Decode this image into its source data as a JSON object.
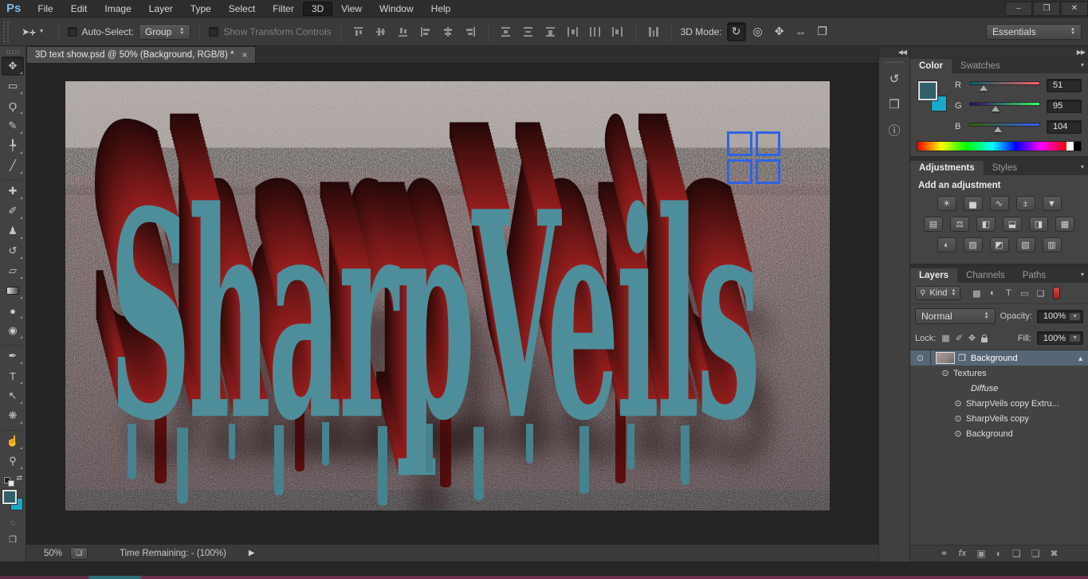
{
  "window": {
    "minimize": "–",
    "restore": "❐",
    "close": "✕"
  },
  "menubar": {
    "logo": "Ps",
    "items": [
      {
        "name": "menu-file",
        "label": "File"
      },
      {
        "name": "menu-edit",
        "label": "Edit"
      },
      {
        "name": "menu-image",
        "label": "Image"
      },
      {
        "name": "menu-layer",
        "label": "Layer"
      },
      {
        "name": "menu-type",
        "label": "Type"
      },
      {
        "name": "menu-select",
        "label": "Select"
      },
      {
        "name": "menu-filter",
        "label": "Filter"
      },
      {
        "name": "menu-3d",
        "label": "3D",
        "cls": "active"
      },
      {
        "name": "menu-view",
        "label": "View"
      },
      {
        "name": "menu-window",
        "label": "Window"
      },
      {
        "name": "menu-help",
        "label": "Help"
      }
    ]
  },
  "options": {
    "auto_select_label": "Auto-Select:",
    "group_value": "Group",
    "show_transform_label": "Show Transform Controls",
    "mode_label": "3D Mode:",
    "modes": [
      {
        "name": "3d-rotate-mode",
        "glyph": "↻",
        "cls": "active"
      },
      {
        "name": "3d-roll-mode",
        "glyph": "◎"
      },
      {
        "name": "3d-drag-mode",
        "glyph": "✥"
      },
      {
        "name": "3d-slide-mode",
        "glyph": "⇔"
      },
      {
        "name": "3d-scale-mode",
        "glyph": "❒"
      }
    ],
    "workspace_value": "Essentials"
  },
  "doc_tab": {
    "title": "3D text show.psd @ 50% (Background, RGB/8) *",
    "close_glyph": "×"
  },
  "tools": [
    {
      "name": "move-tool",
      "glyph": "✥",
      "cls": "selected"
    },
    {
      "name": "marquee-tool",
      "glyph": "▭"
    },
    {
      "name": "lasso-tool",
      "glyph": "Ϙ"
    },
    {
      "name": "quick-selection-tool",
      "glyph": "✎"
    },
    {
      "name": "crop-tool",
      "glyph": "╄"
    },
    {
      "name": "eyedropper-tool",
      "glyph": "╱"
    },
    {
      "cls": "divider"
    },
    {
      "name": "healing-brush-tool",
      "glyph": "✚"
    },
    {
      "name": "brush-tool",
      "glyph": "✐"
    },
    {
      "name": "clone-stamp-tool",
      "glyph": "♟"
    },
    {
      "name": "history-brush-tool",
      "glyph": "↺"
    },
    {
      "name": "eraser-tool",
      "glyph": "▱"
    },
    {
      "name": "gradient-tool",
      "glyph": "",
      "cls": "grad-sw"
    },
    {
      "name": "blur-tool",
      "glyph": "●"
    },
    {
      "name": "dodge-tool",
      "glyph": "◉"
    },
    {
      "cls": "divider"
    },
    {
      "name": "pen-tool",
      "glyph": "✒"
    },
    {
      "name": "type-tool",
      "glyph": "T"
    },
    {
      "name": "path-selection-tool",
      "glyph": "↖"
    },
    {
      "name": "custom-shape-tool",
      "glyph": "❋"
    },
    {
      "cls": "divider"
    },
    {
      "name": "hand-tool",
      "glyph": "☝"
    },
    {
      "name": "zoom-tool",
      "glyph": "⚲"
    }
  ],
  "dock": {
    "collapse_glyph": "◀◀",
    "expand_glyph": "▶▶",
    "items": [
      {
        "name": "history-panel-button",
        "glyph": "↺"
      },
      {
        "name": "3d-panel-button",
        "glyph": "❒"
      },
      {
        "name": "info-panel-button",
        "glyph": "ⓘ"
      }
    ]
  },
  "color_panel": {
    "tabs": [
      {
        "name": "tab-color",
        "label": "Color",
        "cls": "active"
      },
      {
        "name": "tab-swatches",
        "label": "Swatches"
      }
    ],
    "menu_glyph": "≣",
    "channels": [
      {
        "label": "R",
        "value": "51",
        "grad": "linear-gradient(90deg,#005F68,#FF5F68)",
        "pos": "20%"
      },
      {
        "label": "G",
        "value": "95",
        "grad": "linear-gradient(90deg,#330068,#33FF68)",
        "pos": "37%"
      },
      {
        "label": "B",
        "value": "104",
        "grad": "linear-gradient(90deg,#335F00,#335FFF)",
        "pos": "41%"
      }
    ]
  },
  "adjustments_panel": {
    "tabs": [
      {
        "name": "tab-adjustments",
        "label": "Adjustments",
        "cls": "active"
      },
      {
        "name": "tab-styles",
        "label": "Styles"
      }
    ],
    "menu_glyph": "≣",
    "heading": "Add an adjustment",
    "row1": [
      {
        "name": "brightness-contrast-adjustment",
        "glyph": "☀"
      },
      {
        "name": "levels-adjustment",
        "glyph": "▅"
      },
      {
        "name": "curves-adjustment",
        "glyph": "∿"
      },
      {
        "name": "exposure-adjustment",
        "glyph": "±"
      },
      {
        "name": "vibrance-adjustment",
        "glyph": "▼"
      }
    ],
    "row2": [
      {
        "name": "hue-saturation-adjustment",
        "glyph": "▤"
      },
      {
        "name": "color-balance-adjustment",
        "glyph": "⚖"
      },
      {
        "name": "black-white-adjustment",
        "glyph": "◧"
      },
      {
        "name": "photo-filter-adjustment",
        "glyph": "⬓"
      },
      {
        "name": "channel-mixer-adjustment",
        "glyph": "◨"
      },
      {
        "name": "color-lookup-adjustment",
        "glyph": "▦"
      }
    ],
    "row3": [
      {
        "name": "invert-adjustment",
        "glyph": "◐"
      },
      {
        "name": "posterize-adjustment",
        "glyph": "▨"
      },
      {
        "name": "threshold-adjustment",
        "glyph": "◩"
      },
      {
        "name": "gradient-map-adjustment",
        "glyph": "▧"
      },
      {
        "name": "selective-color-adjustment",
        "glyph": "▥"
      }
    ]
  },
  "layers_panel": {
    "tabs": [
      {
        "name": "tab-layers",
        "label": "Layers",
        "cls": "active"
      },
      {
        "name": "tab-channels",
        "label": "Channels"
      },
      {
        "name": "tab-paths",
        "label": "Paths"
      }
    ],
    "menu_glyph": "≣",
    "search_glyph": "⚲",
    "kind_value": "Kind",
    "filter_icons": [
      {
        "name": "filter-pixel-layers",
        "glyph": "▩"
      },
      {
        "name": "filter-adjustment-layers",
        "glyph": "◐"
      },
      {
        "name": "filter-type-layers",
        "glyph": "T"
      },
      {
        "name": "filter-shape-layers",
        "glyph": "▭"
      },
      {
        "name": "filter-smart-objects",
        "glyph": "❏"
      }
    ],
    "blend_value": "Normal",
    "opacity_label": "Opacity:",
    "opacity_value": "100%",
    "lock_label": "Lock:",
    "lock_transparency_glyph": "▦",
    "lock_paint_glyph": "✐",
    "lock_position_glyph": "✥",
    "fill_label": "Fill:",
    "fill_value": "100%",
    "eye_glyph": "⊙",
    "cube_glyph": "❒",
    "group_arrow_glyph": "▲",
    "rows": [
      {
        "label": "Background",
        "eye": true,
        "thumb": true,
        "cube": true,
        "arrow": true,
        "cls": "selected"
      },
      {
        "label": "Textures",
        "eye": true,
        "cls": "ind1"
      },
      {
        "label": "Diffuse",
        "cls": "ind1",
        "style": "padding-left:56px;font-style:italic;color:#e6e6e6"
      },
      {
        "label": "SharpVeils copy Extru...",
        "eye": true,
        "cls": "ind2"
      },
      {
        "label": "SharpVeils copy",
        "eye": true,
        "cls": "ind2"
      },
      {
        "label": "Background",
        "eye": true,
        "cls": "ind2"
      }
    ],
    "bottom_icons": [
      {
        "name": "link-layers-button",
        "glyph": "⚭"
      },
      {
        "name": "layer-effects-button",
        "glyph": "fx",
        "cls": "fx"
      },
      {
        "name": "add-layer-mask-button",
        "glyph": "▣"
      },
      {
        "name": "new-adjustment-layer-button",
        "glyph": "◐"
      },
      {
        "name": "new-group-button",
        "glyph": "❑"
      },
      {
        "name": "new-layer-button",
        "glyph": "❏"
      },
      {
        "name": "delete-layer-button",
        "glyph": "✖"
      }
    ]
  },
  "status_bar": {
    "zoom_value": "50%",
    "doc_icon_glyph": "❏",
    "time_text": "Time Remaining: - (100%)",
    "arrow_glyph": "▶"
  },
  "canvas": {
    "text": "SharpVeils"
  },
  "colors": {
    "foreground": "#335F68",
    "background": "#18A8C8",
    "text_teal": "#4E8E9B",
    "extrude_red": "#8C1A1A",
    "selection_blue": "#2E63E6"
  }
}
